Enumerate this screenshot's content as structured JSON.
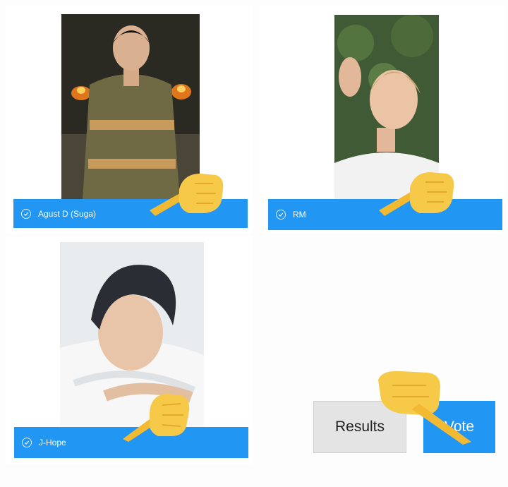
{
  "poll": {
    "options": [
      {
        "label": "Agust D (Suga)",
        "photo": "person-photo-agust-d"
      },
      {
        "label": "RM",
        "photo": "person-photo-rm"
      },
      {
        "label": "J-Hope",
        "photo": "person-photo-j-hope"
      }
    ],
    "results_label": "Results",
    "vote_label": "Vote"
  },
  "colors": {
    "accent": "#2196f3",
    "results_button": "#e4e4e4",
    "pointer_emoji": "#f7c948"
  },
  "icons": {
    "option_check": "check-circle-icon",
    "annotation": "pointing-hand-emoji"
  }
}
